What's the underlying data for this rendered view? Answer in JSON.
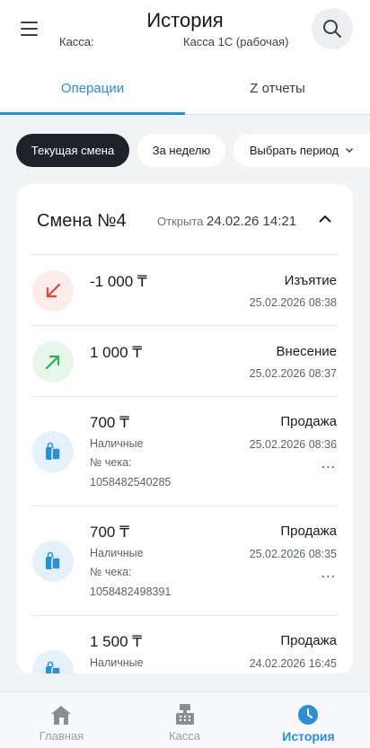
{
  "header": {
    "title": "История",
    "kassa_label": "Касса:",
    "kassa_value": "Касса 1С (рабочая)"
  },
  "tabs": [
    {
      "label": "Операции",
      "active": true
    },
    {
      "label": "Z отчеты",
      "active": false
    }
  ],
  "filters": {
    "current_shift": "Текущая смена",
    "week": "За неделю",
    "choose_period": "Выбрать период"
  },
  "shift": {
    "title": "Смена №4",
    "opened_label": "Открыта",
    "opened_date": "24.02.26 14:21"
  },
  "operations": [
    {
      "amount": "-1 000 ₸",
      "type": "Изъятие",
      "date": "25.02.2026 08:38",
      "icon": "arrow-down-left-icon"
    },
    {
      "amount": "1 000 ₸",
      "type": "Внесение",
      "date": "25.02.2026 08:37",
      "icon": "arrow-up-right-icon"
    },
    {
      "amount": "700 ₸",
      "type": "Продажа",
      "date": "25.02.2026 08:36",
      "payment": "Наличные",
      "receipt_label": "№ чека:",
      "receipt_number": "1058482540285",
      "more": "...",
      "icon": "shopping-bag-icon"
    },
    {
      "amount": "700 ₸",
      "type": "Продажа",
      "date": "25.02.2026 08:35",
      "payment": "Наличные",
      "receipt_label": "№ чека:",
      "receipt_number": "1058482498391",
      "more": "...",
      "icon": "shopping-bag-icon"
    },
    {
      "amount": "1 500 ₸",
      "type": "Продажа",
      "date": "24.02.2026 16:45",
      "payment": "Наличные",
      "icon": "shopping-bag-icon"
    }
  ],
  "bottom_nav": [
    {
      "label": "Главная",
      "icon": "home-icon",
      "active": false
    },
    {
      "label": "Касса",
      "icon": "cash-register-icon",
      "active": false
    },
    {
      "label": "История",
      "icon": "clock-icon",
      "active": true
    }
  ],
  "colors": {
    "accent": "#2b8fd6",
    "withdraw_red": "#e0443a",
    "deposit_green": "#2fae5c",
    "sale_blue": "#2b8fd6",
    "chip_dark": "#1f2329"
  }
}
